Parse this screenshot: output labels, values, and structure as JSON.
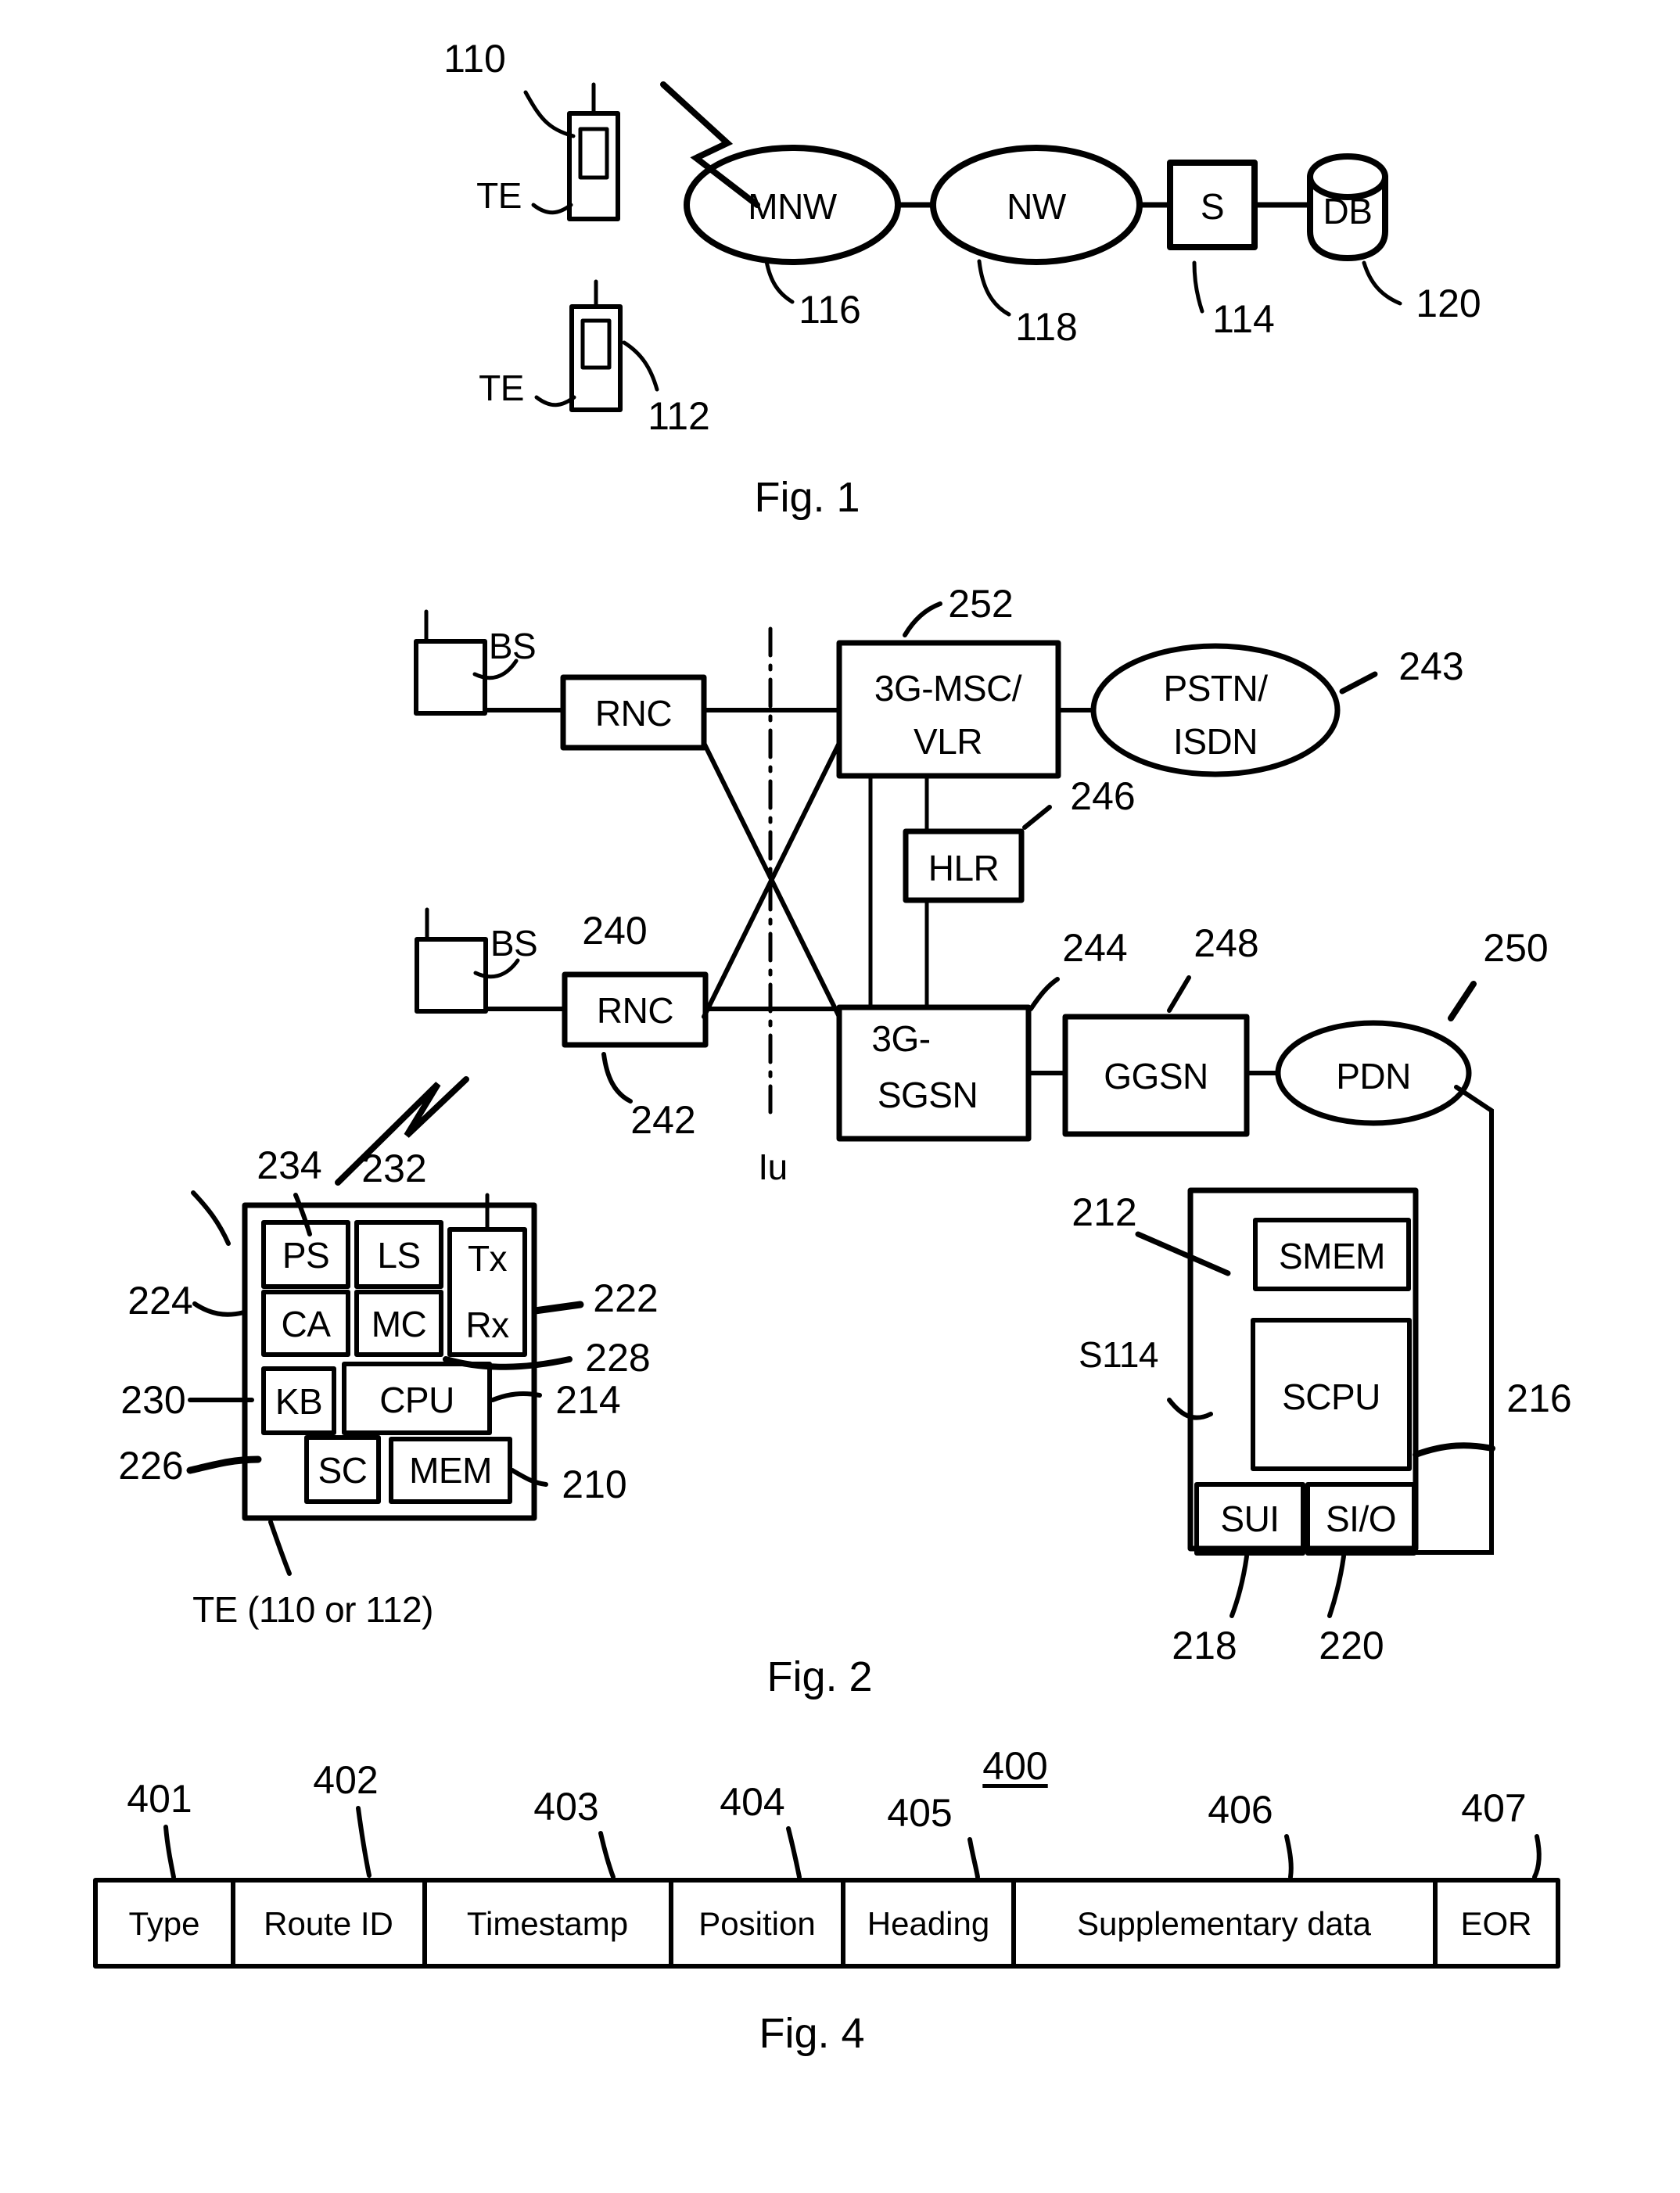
{
  "figures": [
    {
      "id": "fig1",
      "caption": "Fig. 1",
      "nodes": {
        "te1_label": "TE",
        "te2_label": "TE",
        "mnw": "MNW",
        "nw": "NW",
        "server": "S",
        "db": "DB"
      },
      "refs": {
        "te1": "110",
        "te2": "112",
        "mnw": "116",
        "nw": "118",
        "server": "114",
        "db": "120"
      }
    },
    {
      "id": "fig2",
      "caption": "Fig. 2",
      "nodes": {
        "bs_top": "BS",
        "bs_bottom": "BS",
        "rnc_top": "RNC",
        "rnc_bottom": "RNC",
        "msc_line1": "3G-MSC/",
        "msc_line2": "VLR",
        "pstn_line1": "PSTN/",
        "pstn_line2": "ISDN",
        "hlr": "HLR",
        "sgsn_line1": "3G-",
        "sgsn_line2": "SGSN",
        "ggsn": "GGSN",
        "pdn": "PDN",
        "iu_interface": "Iu"
      },
      "refs": {
        "msc": "252",
        "pstn": "243",
        "hlr": "246",
        "bs_bottom": "240",
        "rnc_bottom": "242",
        "sgsn": "244",
        "ggsn": "248",
        "pdn": "250"
      },
      "terminal": {
        "title": "TE  (110 or 112)",
        "blocks": {
          "ps": "PS",
          "ls": "LS",
          "ca": "CA",
          "mc": "MC",
          "txrx_line1": "Tx",
          "txrx_line2": "Rx",
          "kb": "KB",
          "cpu": "CPU",
          "sc": "SC",
          "mem": "MEM"
        },
        "refs": {
          "ps": "234",
          "ls": "232",
          "txrx": "222",
          "ca": "224",
          "antenna": "228",
          "kb": "230",
          "cpu": "214",
          "sc": "226",
          "mem": "210"
        }
      },
      "server": {
        "title": "S114",
        "blocks": {
          "smem": "SMEM",
          "scpu": "SCPU",
          "sui": "SUI",
          "sio": "SI/O"
        },
        "refs": {
          "smem": "212",
          "scpu": "216",
          "sui": "218",
          "sio": "220"
        }
      }
    },
    {
      "id": "fig4",
      "caption": "Fig. 4",
      "record_ref": "400",
      "fields": [
        {
          "ref": "401",
          "label": "Type"
        },
        {
          "ref": "402",
          "label": "Route ID"
        },
        {
          "ref": "403",
          "label": "Timestamp"
        },
        {
          "ref": "404",
          "label": "Position"
        },
        {
          "ref": "405",
          "label": "Heading"
        },
        {
          "ref": "406",
          "label": "Supplementary data"
        },
        {
          "ref": "407",
          "label": "EOR"
        }
      ]
    }
  ],
  "colors": {
    "ink": "#000000",
    "paper": "#ffffff"
  }
}
